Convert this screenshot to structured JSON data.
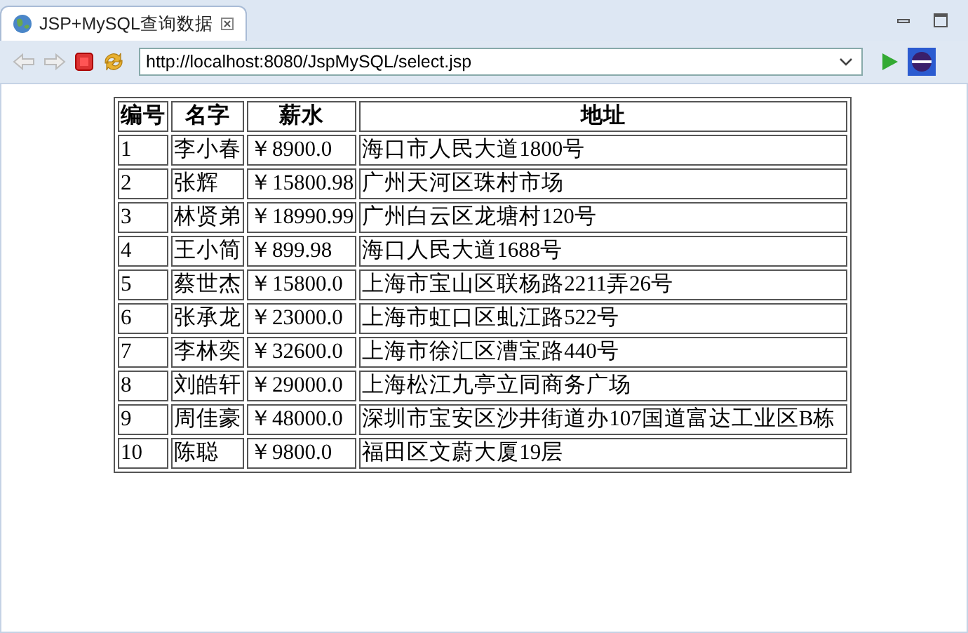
{
  "tab": {
    "title": "JSP+MySQL查询数据",
    "selected": true
  },
  "address": {
    "value": "http://localhost:8080/JspMySQL/select.jsp"
  },
  "table": {
    "columns": [
      "编号",
      "名字",
      "薪水",
      "地址"
    ],
    "rows": [
      [
        "1",
        "李小春",
        "￥8900.0",
        "海口市人民大道1800号"
      ],
      [
        "2",
        "张辉",
        "￥15800.98",
        "广州天河区珠村市场"
      ],
      [
        "3",
        "林贤弟",
        "￥18990.99",
        "广州白云区龙塘村120号"
      ],
      [
        "4",
        "王小简",
        "￥899.98",
        "海口人民大道1688号"
      ],
      [
        "5",
        "蔡世杰",
        "￥15800.0",
        "上海市宝山区联杨路2211弄26号"
      ],
      [
        "6",
        "张承龙",
        "￥23000.0",
        "上海市虹口区虬江路522号"
      ],
      [
        "7",
        "李林奕",
        "￥32600.0",
        "上海市徐汇区漕宝路440号"
      ],
      [
        "8",
        "刘皓轩",
        "￥29000.0",
        "上海松江九亭立同商务广场"
      ],
      [
        "9",
        "周佳豪",
        "￥48000.0",
        "深圳市宝安区沙井街道办107国道富达工业区B栋"
      ],
      [
        "10",
        "陈聪",
        "￥9800.0",
        "福田区文蔚大厦19层"
      ]
    ]
  }
}
